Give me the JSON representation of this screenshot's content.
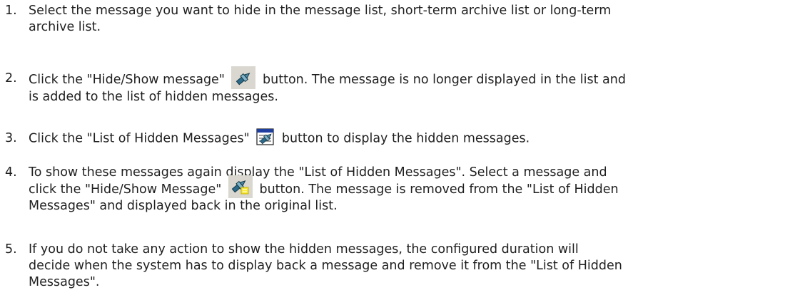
{
  "steps": [
    {
      "number": "1.",
      "line1": "Select the message you want to hide in the message list, short-term archive list or long-term",
      "line2": "archive list."
    },
    {
      "number": "2.",
      "line1_before": "Click the \"Hide/Show message\"",
      "icon": "hide-show-message-icon",
      "line1_after": "button. The message is no longer displayed in the list and",
      "line2": "is added to the list of hidden messages."
    },
    {
      "number": "3.",
      "line1_before": "Click the \"List of Hidden Messages\"",
      "icon": "list-of-hidden-messages-icon",
      "line1_after": "button to display the hidden messages."
    },
    {
      "number": "4.",
      "line1_part_a": "To show these messages again",
      "line1_part_b": "display the \"List of Hidden Messages\". Select a message and",
      "line2_before": "click the \"Hide/Show Message\"",
      "icon": "show-message-icon",
      "line2_after": "button. The message is removed from the \"List of Hidden",
      "line3": "Messages\" and displayed back in the original list."
    },
    {
      "number": "5.",
      "line1": "If you do not take any action to show the hidden messages, the configured duration will",
      "line2": "decide when the system has to display back a message and remove it from the \"List of Hidden",
      "line3": "Messages\"."
    }
  ],
  "colors": {
    "text": "#1f1f1f",
    "icon_background": "#d9d7cf"
  }
}
